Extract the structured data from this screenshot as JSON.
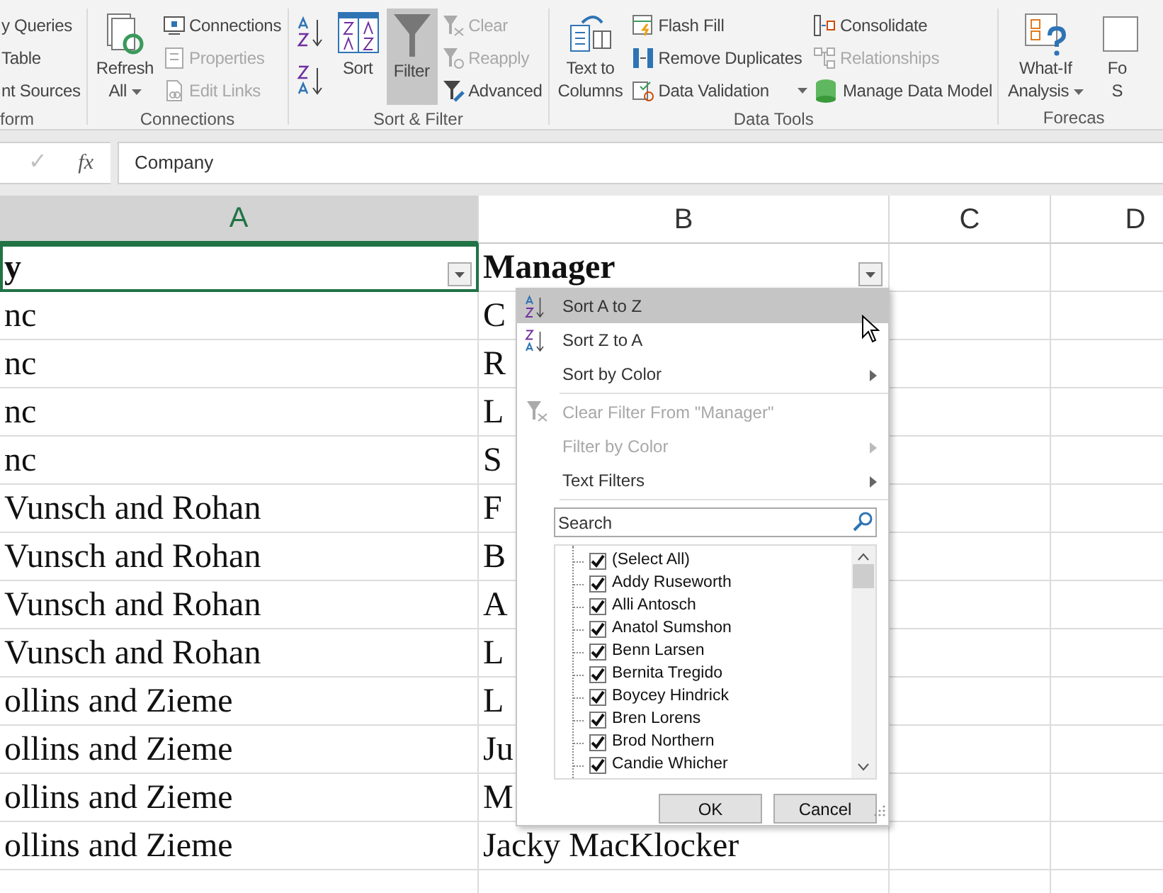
{
  "ribbon": {
    "groups": [
      {
        "label": "form",
        "items": [
          {
            "kind": "small",
            "label": "y Queries",
            "disabled": false,
            "pressed": false,
            "dropdown": false
          },
          {
            "kind": "small",
            "label": "Table",
            "disabled": false,
            "pressed": false,
            "dropdown": false
          },
          {
            "kind": "small",
            "label": "nt Sources",
            "disabled": false,
            "pressed": false,
            "dropdown": false
          }
        ]
      },
      {
        "label": "Connections",
        "items": [
          {
            "kind": "large",
            "lines": [
              "Refresh",
              "All"
            ],
            "disabled": false,
            "pressed": false,
            "dropdown": true
          },
          {
            "kind": "small",
            "label": "Connections",
            "disabled": false,
            "pressed": false,
            "dropdown": false
          },
          {
            "kind": "small",
            "label": "Properties",
            "disabled": true,
            "pressed": false,
            "dropdown": false
          },
          {
            "kind": "small",
            "label": "Edit Links",
            "disabled": true,
            "pressed": false,
            "dropdown": false
          }
        ]
      },
      {
        "label": "Sort & Filter",
        "items": [
          {
            "kind": "icon",
            "disabled": false,
            "pressed": false,
            "dropdown": false
          },
          {
            "kind": "icon",
            "disabled": false,
            "pressed": false,
            "dropdown": false
          },
          {
            "kind": "large",
            "lines": [
              "Sort"
            ],
            "disabled": false,
            "pressed": false,
            "dropdown": false
          },
          {
            "kind": "large",
            "lines": [
              "Filter"
            ],
            "disabled": false,
            "pressed": true,
            "dropdown": false
          },
          {
            "kind": "small",
            "label": "Clear",
            "disabled": true,
            "pressed": false,
            "dropdown": false
          },
          {
            "kind": "small",
            "label": "Reapply",
            "disabled": true,
            "pressed": false,
            "dropdown": false
          },
          {
            "kind": "small",
            "label": "Advanced",
            "disabled": false,
            "pressed": false,
            "dropdown": false
          }
        ]
      },
      {
        "label": "Data Tools",
        "items": [
          {
            "kind": "large",
            "lines": [
              "Text to",
              "Columns"
            ],
            "disabled": false,
            "pressed": false,
            "dropdown": false
          },
          {
            "kind": "small",
            "label": "Flash Fill",
            "disabled": false,
            "pressed": false,
            "dropdown": false
          },
          {
            "kind": "small",
            "label": "Remove Duplicates",
            "disabled": false,
            "pressed": false,
            "dropdown": false
          },
          {
            "kind": "small",
            "label": "Data Validation",
            "disabled": false,
            "pressed": false,
            "dropdown": true
          },
          {
            "kind": "small",
            "label": "Consolidate",
            "disabled": false,
            "pressed": false,
            "dropdown": false
          },
          {
            "kind": "small",
            "label": "Relationships",
            "disabled": true,
            "pressed": false,
            "dropdown": false
          },
          {
            "kind": "small",
            "label": "Manage Data Model",
            "disabled": false,
            "pressed": false,
            "dropdown": false
          }
        ]
      },
      {
        "label": "Forecas",
        "items": [
          {
            "kind": "large",
            "lines": [
              "What-If",
              "Analysis"
            ],
            "disabled": false,
            "pressed": false,
            "dropdown": true
          },
          {
            "kind": "large",
            "lines": [
              "Fo",
              "S"
            ],
            "disabled": false,
            "pressed": false,
            "dropdown": false
          }
        ]
      }
    ]
  },
  "formula_bar": {
    "confirm_symbol": "✓",
    "confirm_disabled": true,
    "function_symbol": "fx",
    "value": "Company"
  },
  "sheet": {
    "columns": [
      {
        "label": "A",
        "selected": true
      },
      {
        "label": "B",
        "selected": false
      },
      {
        "label": "C",
        "selected": false
      },
      {
        "label": "D",
        "selected": false
      }
    ],
    "header_row": [
      {
        "text": "y",
        "filter": true,
        "active": true
      },
      {
        "text": "Manager",
        "filter": true,
        "active": false
      }
    ],
    "rows": [
      [
        "nc",
        "C"
      ],
      [
        "nc",
        "R"
      ],
      [
        "nc",
        "L"
      ],
      [
        "nc",
        "S"
      ],
      [
        "Vunsch and Rohan",
        "F"
      ],
      [
        "Vunsch and Rohan",
        "B"
      ],
      [
        "Vunsch and Rohan",
        "A"
      ],
      [
        "Vunsch and Rohan",
        "L"
      ],
      [
        "ollins and Zieme",
        "L"
      ],
      [
        "ollins and Zieme",
        "Ju"
      ],
      [
        "ollins and Zieme",
        "M"
      ],
      [
        "ollins and Zieme",
        "Jacky MacKlocker"
      ]
    ]
  },
  "filter_menu": {
    "items": [
      {
        "kind": "ascending",
        "label": "Sort A to Z",
        "highlighted": true,
        "disabled": false,
        "submenu": false
      },
      {
        "kind": "descending",
        "label": "Sort Z to A",
        "highlighted": false,
        "disabled": false,
        "submenu": false
      },
      {
        "kind": "plain",
        "label": "Sort by Color",
        "highlighted": false,
        "disabled": false,
        "submenu": true
      },
      {
        "kind": "divider"
      },
      {
        "kind": "clear",
        "label": "Clear Filter From \"Manager\"",
        "highlighted": false,
        "disabled": true,
        "submenu": false
      },
      {
        "kind": "plain",
        "label": "Filter by Color",
        "highlighted": false,
        "disabled": true,
        "submenu": true
      },
      {
        "kind": "plain",
        "label": "Text Filters",
        "highlighted": false,
        "disabled": false,
        "submenu": true
      },
      {
        "kind": "divider"
      }
    ],
    "search": {
      "placeholder": "Search"
    },
    "values": [
      {
        "label": "(Select All)",
        "checked": true
      },
      {
        "label": "Addy Ruseworth",
        "checked": true
      },
      {
        "label": "Alli Antosch",
        "checked": true
      },
      {
        "label": "Anatol Sumshon",
        "checked": true
      },
      {
        "label": "Benn Larsen",
        "checked": true
      },
      {
        "label": "Bernita Tregido",
        "checked": true
      },
      {
        "label": "Boycey Hindrick",
        "checked": true
      },
      {
        "label": "Bren Lorens",
        "checked": true
      },
      {
        "label": "Brod Northern",
        "checked": true
      },
      {
        "label": "Candie Whicher",
        "checked": true
      }
    ],
    "buttons": [
      "OK",
      "Cancel"
    ]
  }
}
